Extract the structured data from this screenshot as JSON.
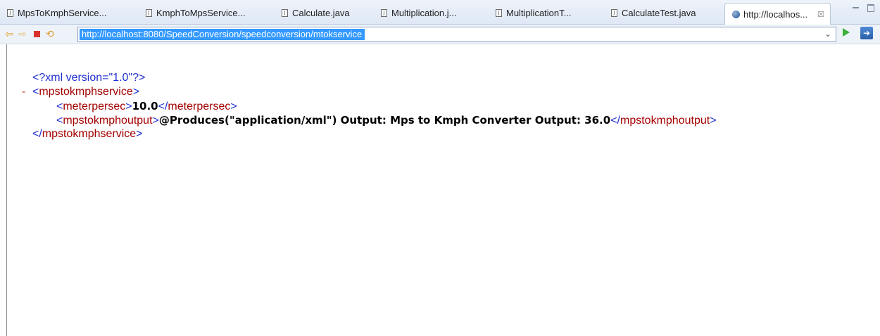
{
  "tabs": [
    {
      "label": "MpsToKmphService...",
      "type": "java"
    },
    {
      "label": "KmphToMpsService...",
      "type": "java"
    },
    {
      "label": "Calculate.java",
      "type": "java"
    },
    {
      "label": "Multiplication.j...",
      "type": "java"
    },
    {
      "label": "MultiplicationT...",
      "type": "java"
    },
    {
      "label": "CalculateTest.java",
      "type": "java"
    },
    {
      "label": "http://localhos...",
      "type": "browser",
      "active": true,
      "close": "☒"
    }
  ],
  "toolbar": {
    "url": "http://localhost:8080/SpeedConversion/speedconversion/mtokservice",
    "dropdown_glyph": "⌄",
    "export_glyph": "➔"
  },
  "xml": {
    "declaration": "<?xml version=\"1.0\"?>",
    "collapse_marker": "-",
    "root_tag": "mpstokmphservice",
    "meterpersec_tag": "meterpersec",
    "meterpersec_value": "10.0",
    "output_tag": "mpstokmphoutput",
    "output_value": "@Produces(\"application/xml\") Output: Mps to Kmph Converter Output: 36.0"
  },
  "colors": {
    "tag_bracket": "#1f2fd0",
    "tag_name": "#a40000",
    "url_highlight": "#3399ff"
  }
}
